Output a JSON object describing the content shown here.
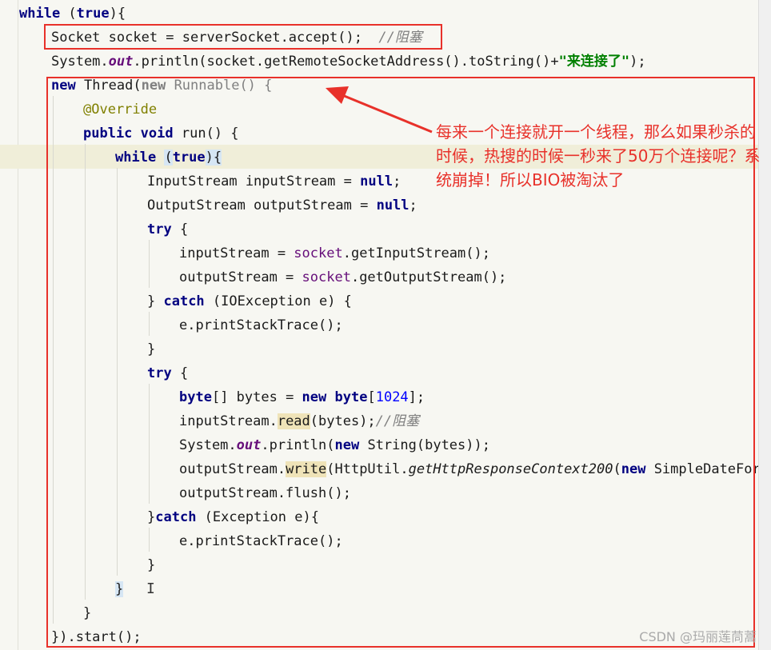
{
  "code": {
    "l1": [
      "while",
      " (",
      "true",
      "){"
    ],
    "l2": [
      "Socket socket = serverSocket.accept();  ",
      "//阻塞"
    ],
    "l3": [
      "System.",
      "out",
      ".println(socket.getRemoteSocketAddress().toString()+",
      "\"来连接了\"",
      ");"
    ],
    "l4": [
      "new",
      " Thread(",
      "new",
      " Runnable() {"
    ],
    "l5": [
      "@Override"
    ],
    "l6": [
      "public",
      " ",
      "void",
      " run() {"
    ],
    "l7": [
      "while",
      " ",
      "(",
      "true",
      ")",
      "{"
    ],
    "l8": [
      "InputStream inputStream = ",
      "null",
      ";"
    ],
    "l9": [
      "OutputStream outputStream = ",
      "null",
      ";"
    ],
    "l10": [
      "try",
      " {"
    ],
    "l11": [
      "inputStream = ",
      "socket",
      ".getInputStream();"
    ],
    "l12": [
      "outputStream = ",
      "socket",
      ".getOutputStream();"
    ],
    "l13": [
      "} ",
      "catch",
      " (IOException e) {"
    ],
    "l14": [
      "e.printStackTrace();"
    ],
    "l15": [
      "}"
    ],
    "l16": [
      "try",
      " {"
    ],
    "l17": [
      "byte",
      "[] bytes = ",
      "new",
      " ",
      "byte",
      "[",
      "1024",
      "];"
    ],
    "l18": [
      "inputStream.",
      "read",
      "(bytes);",
      "//阻塞"
    ],
    "l19": [
      "System.",
      "out",
      ".println(",
      "new",
      " String(bytes));"
    ],
    "l20": [
      "outputStream.",
      "write",
      "(HttpUtil.",
      "getHttpResponseContext200",
      "(",
      "new",
      " SimpleDateForm"
    ],
    "l21": [
      "outputStream.flush();"
    ],
    "l22": [
      "}",
      "catch",
      " (Exception e){"
    ],
    "l23": [
      "e.printStackTrace();"
    ],
    "l24": [
      "}"
    ],
    "l25": [
      "}"
    ],
    "l26": [
      "}"
    ],
    "l27": [
      "}).start();"
    ]
  },
  "annotation": "每来一个连接就开一个线程，那么如果秒杀的时候，热搜的时候一秒来了50万个连接呢？系统崩掉！所以BIO被淘汰了",
  "watermark": "CSDN @玛丽莲茼蒿",
  "colors": {
    "annotation": "#e8312a",
    "keyword": "#000080",
    "string": "#008000",
    "comment": "#808080"
  }
}
